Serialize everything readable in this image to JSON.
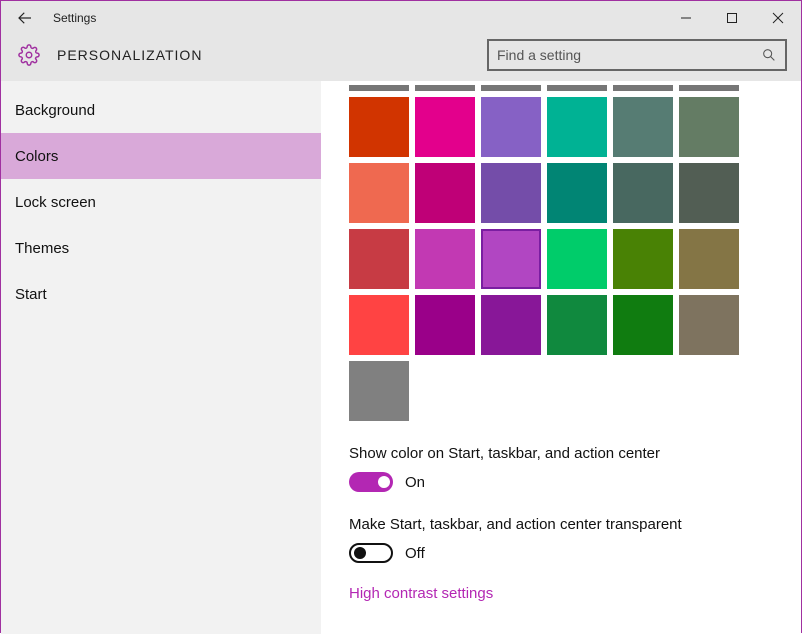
{
  "window": {
    "title": "Settings"
  },
  "header": {
    "section": "PERSONALIZATION",
    "search_placeholder": "Find a setting"
  },
  "sidebar": {
    "items": [
      {
        "label": "Background"
      },
      {
        "label": "Colors"
      },
      {
        "label": "Lock screen"
      },
      {
        "label": "Themes"
      },
      {
        "label": "Start"
      }
    ],
    "selected_index": 1
  },
  "colors": {
    "peek": [
      "#767676",
      "#767676",
      "#767676",
      "#767676",
      "#767676",
      "#767676"
    ],
    "rows": [
      [
        "#d13400",
        "#e3008c",
        "#8661c5",
        "#00b294",
        "#567c73",
        "#647c64"
      ],
      [
        "#ef6950",
        "#bf0077",
        "#744da9",
        "#018574",
        "#486860",
        "#525e54"
      ],
      [
        "#c73b44",
        "#c239b3",
        "#b146c2",
        "#00cc6a",
        "#498205",
        "#847545"
      ],
      [
        "#ff4343",
        "#9a0089",
        "#881798",
        "#10893e",
        "#107c10",
        "#7e735f"
      ],
      [
        "#808080"
      ]
    ],
    "selected": {
      "row": 2,
      "col": 2
    }
  },
  "settings": {
    "show_color": {
      "label": "Show color on Start, taskbar, and action center",
      "state": "On",
      "on": true
    },
    "transparent": {
      "label": "Make Start, taskbar, and action center transparent",
      "state": "Off",
      "on": false
    },
    "link": "High contrast settings"
  }
}
